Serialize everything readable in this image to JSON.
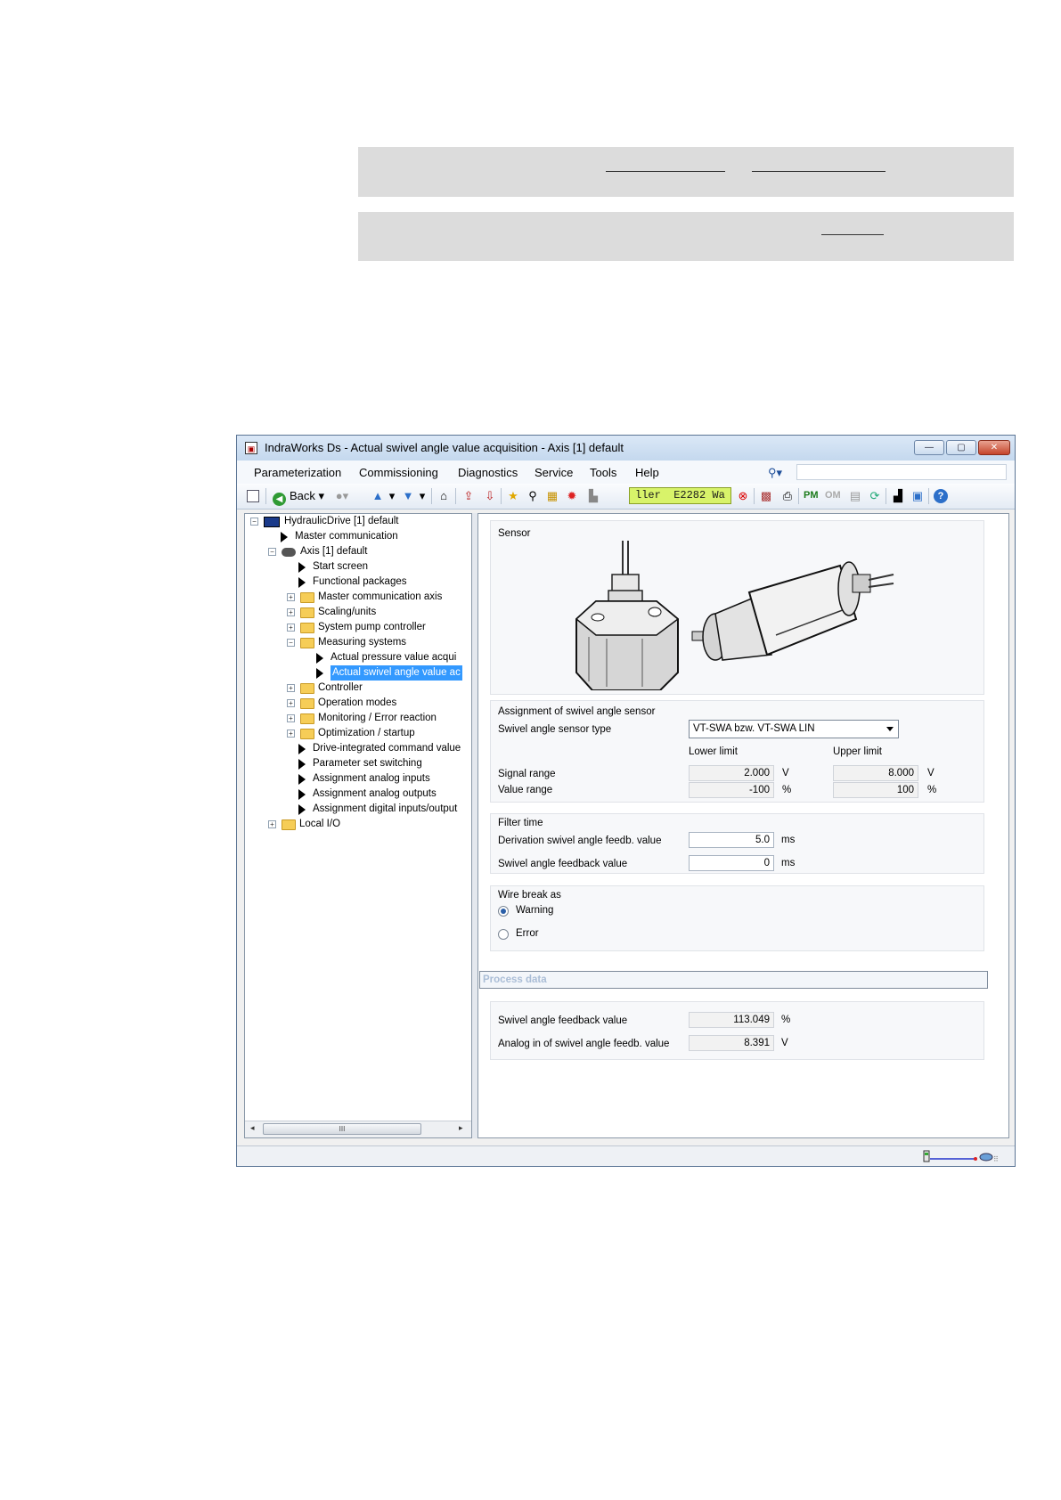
{
  "window": {
    "title": "IndraWorks Ds - Actual swivel angle value acquisition - Axis [1] default"
  },
  "menu": [
    "Parameterization",
    "Commissioning",
    "Diagnostics",
    "Service",
    "Tools",
    "Help"
  ],
  "toolbar": {
    "back_label": "Back",
    "diag_text": "ller  E2282 Wa",
    "pm_label": "PM",
    "om_label": "OM"
  },
  "tree": {
    "root": "HydraulicDrive [1] default",
    "master_comm": "Master communication",
    "axis": "Axis [1] default",
    "start_screen": "Start screen",
    "functional_packages": "Functional packages",
    "master_comm_axis": "Master communication axis",
    "scaling": "Scaling/units",
    "pump": "System pump controller",
    "measuring": "Measuring systems",
    "pressure_acq": "Actual pressure value acqui",
    "swivel_acq": "Actual swivel angle value ac",
    "controller": "Controller",
    "operation_modes": "Operation modes",
    "monitoring": "Monitoring / Error reaction",
    "optimization": "Optimization / startup",
    "drive_cmd": "Drive-integrated command value",
    "param_set": "Parameter set switching",
    "analog_in": "Assignment analog inputs",
    "analog_out": "Assignment analog outputs",
    "digital_io": "Assignment digital inputs/output",
    "local_io": "Local I/O"
  },
  "panel": {
    "sensor_group": "Sensor",
    "assignment_group": "Assignment of swivel angle sensor",
    "sensor_type_label": "Swivel angle sensor type",
    "sensor_type_value": "VT-SWA bzw. VT-SWA LIN",
    "lower_limit": "Lower limit",
    "upper_limit": "Upper limit",
    "signal_range_label": "Signal range",
    "signal_lower": "2.000",
    "signal_unit_lower": "V",
    "signal_upper": "8.000",
    "signal_unit_upper": "V",
    "value_range_label": "Value range",
    "value_lower": "-100",
    "value_unit_lower": "%",
    "value_upper": "100",
    "value_unit_upper": "%",
    "filter_group": "Filter time",
    "deriv_label": "Derivation swivel angle feedb. value",
    "deriv_value": "5.0",
    "deriv_unit": "ms",
    "feedback_label": "Swivel angle feedback value",
    "feedback_value": "0",
    "feedback_unit": "ms",
    "wire_group": "Wire break as",
    "warning_label": "Warning",
    "error_label": "Error",
    "process_data": "Process data",
    "pd_feedback_label": "Swivel angle feedback value",
    "pd_feedback_value": "113.049",
    "pd_feedback_unit": "%",
    "pd_analog_label": "Analog in of swivel angle feedb. value",
    "pd_analog_value": "8.391",
    "pd_analog_unit": "V"
  }
}
